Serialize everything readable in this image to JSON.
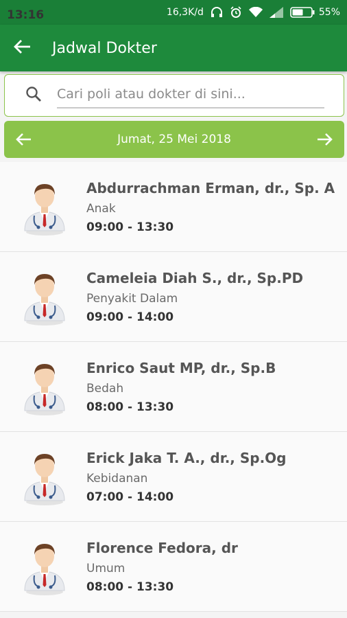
{
  "status_bar": {
    "time": "13:16",
    "network_speed": "16,3K/d",
    "battery": "55%"
  },
  "app_bar": {
    "title": "Jadwal Dokter"
  },
  "search": {
    "placeholder": "Cari poli atau dokter di sini..."
  },
  "date_nav": {
    "date_label": "Jumat, 25 Mei 2018"
  },
  "doctors": [
    {
      "name": "Abdurrachman Erman, dr., Sp. A",
      "poli": "Anak",
      "time": "09:00 - 13:30"
    },
    {
      "name": "Cameleia Diah S., dr., Sp.PD",
      "poli": "Penyakit Dalam",
      "time": "09:00 - 14:00"
    },
    {
      "name": "Enrico Saut MP, dr., Sp.B",
      "poli": "Bedah",
      "time": "08:00 - 13:30"
    },
    {
      "name": "Erick Jaka T. A., dr., Sp.Og",
      "poli": "Kebidanan",
      "time": "07:00 - 14:00"
    },
    {
      "name": "Florence Fedora, dr",
      "poli": "Umum",
      "time": "08:00 - 13:30"
    }
  ],
  "colors": {
    "primary": "#1e8a3c",
    "accent": "#8bc34a"
  }
}
